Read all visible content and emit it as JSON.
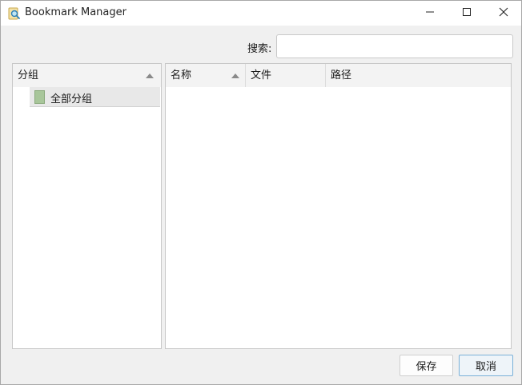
{
  "window": {
    "title": "Bookmark Manager"
  },
  "search": {
    "label": "搜索:",
    "value": "",
    "placeholder": ""
  },
  "groups_panel": {
    "header": "分组",
    "items": [
      {
        "label": "全部分组"
      }
    ]
  },
  "bookmarks_table": {
    "columns": [
      {
        "label": "名称"
      },
      {
        "label": "文件"
      },
      {
        "label": "路径"
      }
    ],
    "rows": []
  },
  "buttons": {
    "save_label": "保存",
    "cancel_label": "取消"
  },
  "icons": {
    "app": "magnifier-icon",
    "minimize": "minimize-icon",
    "maximize": "maximize-icon",
    "close": "close-icon",
    "folder": "folder-icon",
    "sort": "sort-ascending-icon"
  },
  "colors": {
    "folder_fill": "#a8c69a",
    "focus_border": "#7ab0d8",
    "selection_bg": "#e8e8e8"
  }
}
